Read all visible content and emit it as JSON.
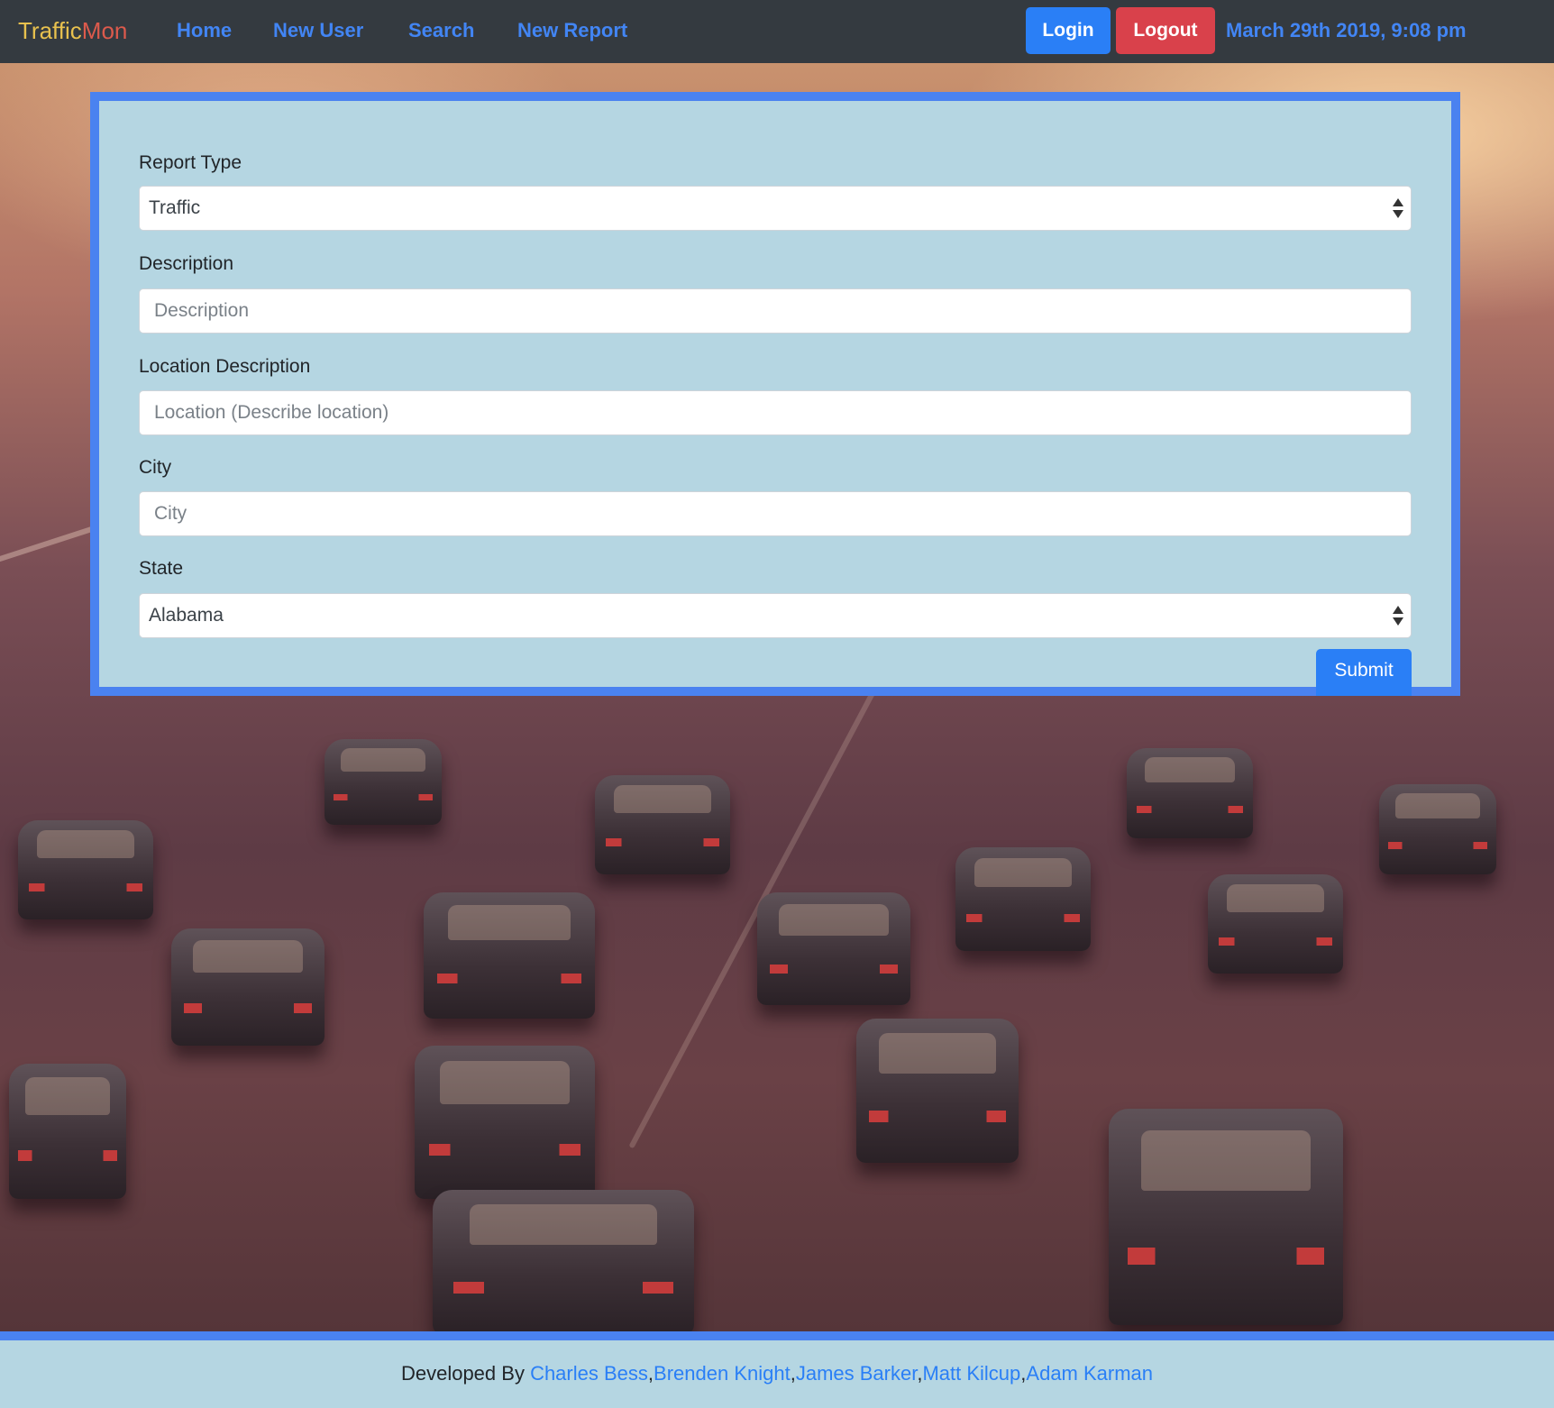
{
  "navbar": {
    "brand_part1": "Traffic",
    "brand_part2": "Mon",
    "links": [
      "Home",
      "New User",
      "Search",
      "New Report"
    ],
    "login_label": "Login",
    "logout_label": "Logout",
    "datetime": "March 29th 2019, 9:08 pm"
  },
  "form": {
    "report_type_label": "Report Type",
    "report_type_value": "Traffic",
    "description_label": "Description",
    "description_placeholder": "Description",
    "location_label": "Location Description",
    "location_placeholder": "Location (Describe location)",
    "city_label": "City",
    "city_placeholder": "City",
    "state_label": "State",
    "state_value": "Alabama",
    "submit_label": "Submit"
  },
  "footer": {
    "prefix": "Developed By ",
    "developers": [
      "Charles Bess",
      "Brenden Knight",
      "James Barker",
      "Matt Kilcup",
      "Adam Karman"
    ],
    "separator": ","
  },
  "colors": {
    "navbar_bg": "#343a40",
    "accent_blue": "#4285f4",
    "logout_red": "#d9414b",
    "card_bg": "#b5d6e2",
    "card_border": "#4a82f0",
    "brand_yellow": "#e8c14e",
    "brand_red": "#dc5a4c"
  }
}
